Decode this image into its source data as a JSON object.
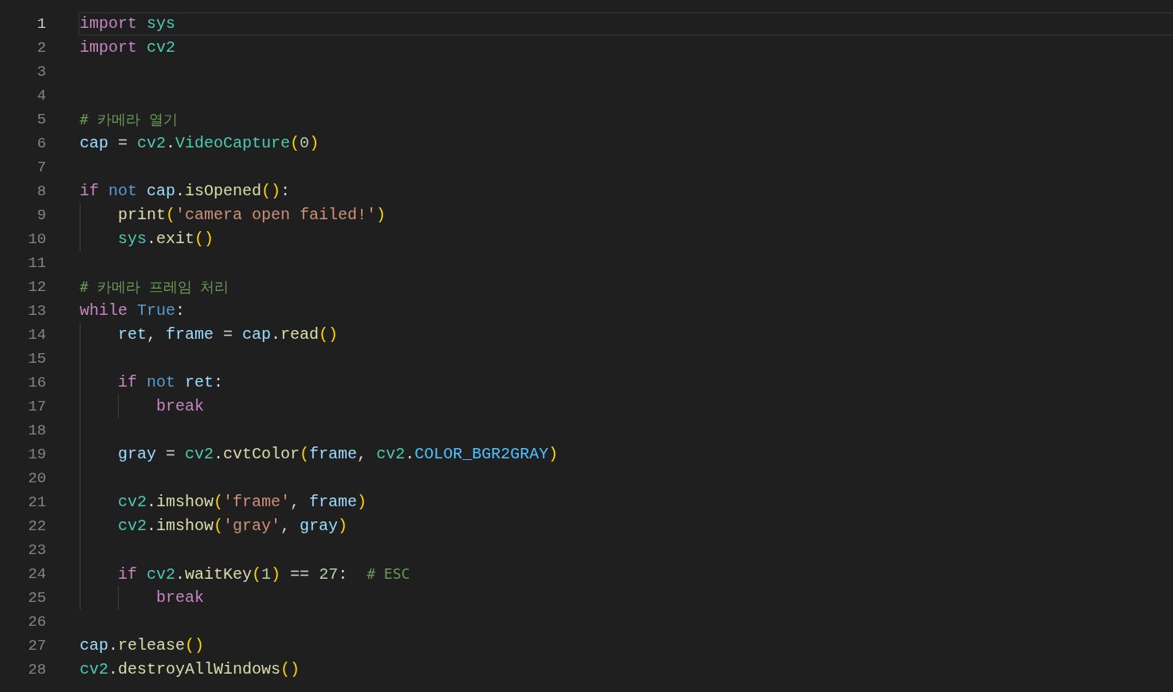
{
  "editor": {
    "lines": [
      {
        "number": "1",
        "current": true,
        "tokens": [
          {
            "kind": "kw",
            "text": "import "
          },
          {
            "kind": "mod",
            "text": "sys"
          }
        ]
      },
      {
        "number": "2",
        "current": false,
        "tokens": [
          {
            "kind": "kw",
            "text": "import "
          },
          {
            "kind": "mod",
            "text": "cv2"
          }
        ]
      },
      {
        "number": "3",
        "current": false
      },
      {
        "number": "4",
        "current": false
      },
      {
        "number": "5",
        "current": false,
        "tokens": [
          {
            "kind": "com",
            "text": "# 카메라 열기"
          }
        ]
      },
      {
        "number": "6",
        "current": false,
        "tokens": [
          {
            "kind": "var",
            "text": "cap"
          },
          {
            "kind": "p",
            "text": " = "
          },
          {
            "kind": "mod",
            "text": "cv2"
          },
          {
            "kind": "p",
            "text": "."
          },
          {
            "kind": "cls",
            "text": "VideoCapture"
          },
          {
            "kind": "br",
            "text": "("
          },
          {
            "kind": "num",
            "text": "0"
          },
          {
            "kind": "br",
            "text": ")"
          }
        ]
      },
      {
        "number": "7",
        "current": false
      },
      {
        "number": "8",
        "current": false,
        "tokens": [
          {
            "kind": "kw",
            "text": "if "
          },
          {
            "kind": "kw2",
            "text": "not "
          },
          {
            "kind": "var",
            "text": "cap"
          },
          {
            "kind": "p",
            "text": "."
          },
          {
            "kind": "fn",
            "text": "isOpened"
          },
          {
            "kind": "br",
            "text": "()"
          },
          {
            "kind": "p",
            "text": ":"
          }
        ]
      },
      {
        "number": "9",
        "current": false,
        "tokens": [
          {
            "kind": "fn",
            "text": "    print"
          },
          {
            "kind": "br",
            "text": "("
          },
          {
            "kind": "str",
            "text": "'camera open failed!'"
          },
          {
            "kind": "br",
            "text": ")"
          }
        ]
      },
      {
        "number": "10",
        "current": false,
        "tokens": [
          {
            "kind": "mod",
            "text": "    sys"
          },
          {
            "kind": "p",
            "text": "."
          },
          {
            "kind": "fn",
            "text": "exit"
          },
          {
            "kind": "br",
            "text": "()"
          }
        ]
      },
      {
        "number": "11",
        "current": false
      },
      {
        "number": "12",
        "current": false,
        "tokens": [
          {
            "kind": "com",
            "text": "# 카메라 프레임 처리"
          }
        ]
      },
      {
        "number": "13",
        "current": false,
        "tokens": [
          {
            "kind": "kw",
            "text": "while "
          },
          {
            "kind": "kw2",
            "text": "True"
          },
          {
            "kind": "p",
            "text": ":"
          }
        ]
      },
      {
        "number": "14",
        "current": false,
        "tokens": [
          {
            "kind": "var",
            "text": "    ret"
          },
          {
            "kind": "p",
            "text": ", "
          },
          {
            "kind": "var",
            "text": "frame"
          },
          {
            "kind": "p",
            "text": " = "
          },
          {
            "kind": "var",
            "text": "cap"
          },
          {
            "kind": "p",
            "text": "."
          },
          {
            "kind": "fn",
            "text": "read"
          },
          {
            "kind": "br",
            "text": "()"
          }
        ]
      },
      {
        "number": "15",
        "current": false
      },
      {
        "number": "16",
        "current": false,
        "tokens": [
          {
            "kind": "kw",
            "text": "    if "
          },
          {
            "kind": "kw2",
            "text": "not "
          },
          {
            "kind": "var",
            "text": "ret"
          },
          {
            "kind": "p",
            "text": ":"
          }
        ]
      },
      {
        "number": "17",
        "current": false,
        "tokens": [
          {
            "kind": "kw",
            "text": "        break"
          }
        ]
      },
      {
        "number": "18",
        "current": false
      },
      {
        "number": "19",
        "current": false,
        "tokens": [
          {
            "kind": "var",
            "text": "    gray"
          },
          {
            "kind": "p",
            "text": " = "
          },
          {
            "kind": "mod",
            "text": "cv2"
          },
          {
            "kind": "p",
            "text": "."
          },
          {
            "kind": "fn",
            "text": "cvtColor"
          },
          {
            "kind": "br",
            "text": "("
          },
          {
            "kind": "var",
            "text": "frame"
          },
          {
            "kind": "p",
            "text": ", "
          },
          {
            "kind": "mod",
            "text": "cv2"
          },
          {
            "kind": "p",
            "text": "."
          },
          {
            "kind": "const",
            "text": "COLOR_BGR2GRAY"
          },
          {
            "kind": "br",
            "text": ")"
          }
        ]
      },
      {
        "number": "20",
        "current": false
      },
      {
        "number": "21",
        "current": false,
        "tokens": [
          {
            "kind": "mod",
            "text": "    cv2"
          },
          {
            "kind": "p",
            "text": "."
          },
          {
            "kind": "fn",
            "text": "imshow"
          },
          {
            "kind": "br",
            "text": "("
          },
          {
            "kind": "str",
            "text": "'frame'"
          },
          {
            "kind": "p",
            "text": ", "
          },
          {
            "kind": "var",
            "text": "frame"
          },
          {
            "kind": "br",
            "text": ")"
          }
        ]
      },
      {
        "number": "22",
        "current": false,
        "tokens": [
          {
            "kind": "mod",
            "text": "    cv2"
          },
          {
            "kind": "p",
            "text": "."
          },
          {
            "kind": "fn",
            "text": "imshow"
          },
          {
            "kind": "br",
            "text": "("
          },
          {
            "kind": "str",
            "text": "'gray'"
          },
          {
            "kind": "p",
            "text": ", "
          },
          {
            "kind": "var",
            "text": "gray"
          },
          {
            "kind": "br",
            "text": ")"
          }
        ]
      },
      {
        "number": "23",
        "current": false
      },
      {
        "number": "24",
        "current": false,
        "tokens": [
          {
            "kind": "kw",
            "text": "    if "
          },
          {
            "kind": "mod",
            "text": "cv2"
          },
          {
            "kind": "p",
            "text": "."
          },
          {
            "kind": "fn",
            "text": "waitKey"
          },
          {
            "kind": "br",
            "text": "("
          },
          {
            "kind": "num",
            "text": "1"
          },
          {
            "kind": "br",
            "text": ")"
          },
          {
            "kind": "p",
            "text": " == "
          },
          {
            "kind": "num",
            "text": "27"
          },
          {
            "kind": "p",
            "text": ":  "
          },
          {
            "kind": "com",
            "text": "# ESC"
          }
        ]
      },
      {
        "number": "25",
        "current": false,
        "tokens": [
          {
            "kind": "kw",
            "text": "        break"
          }
        ]
      },
      {
        "number": "26",
        "current": false
      },
      {
        "number": "27",
        "current": false,
        "tokens": [
          {
            "kind": "var",
            "text": "cap"
          },
          {
            "kind": "p",
            "text": "."
          },
          {
            "kind": "fn",
            "text": "release"
          },
          {
            "kind": "br",
            "text": "()"
          }
        ]
      },
      {
        "number": "28",
        "current": false,
        "tokens": [
          {
            "kind": "mod",
            "text": "cv2"
          },
          {
            "kind": "p",
            "text": "."
          },
          {
            "kind": "fn",
            "text": "destroyAllWindows"
          },
          {
            "kind": "br",
            "text": "()"
          }
        ]
      }
    ]
  }
}
